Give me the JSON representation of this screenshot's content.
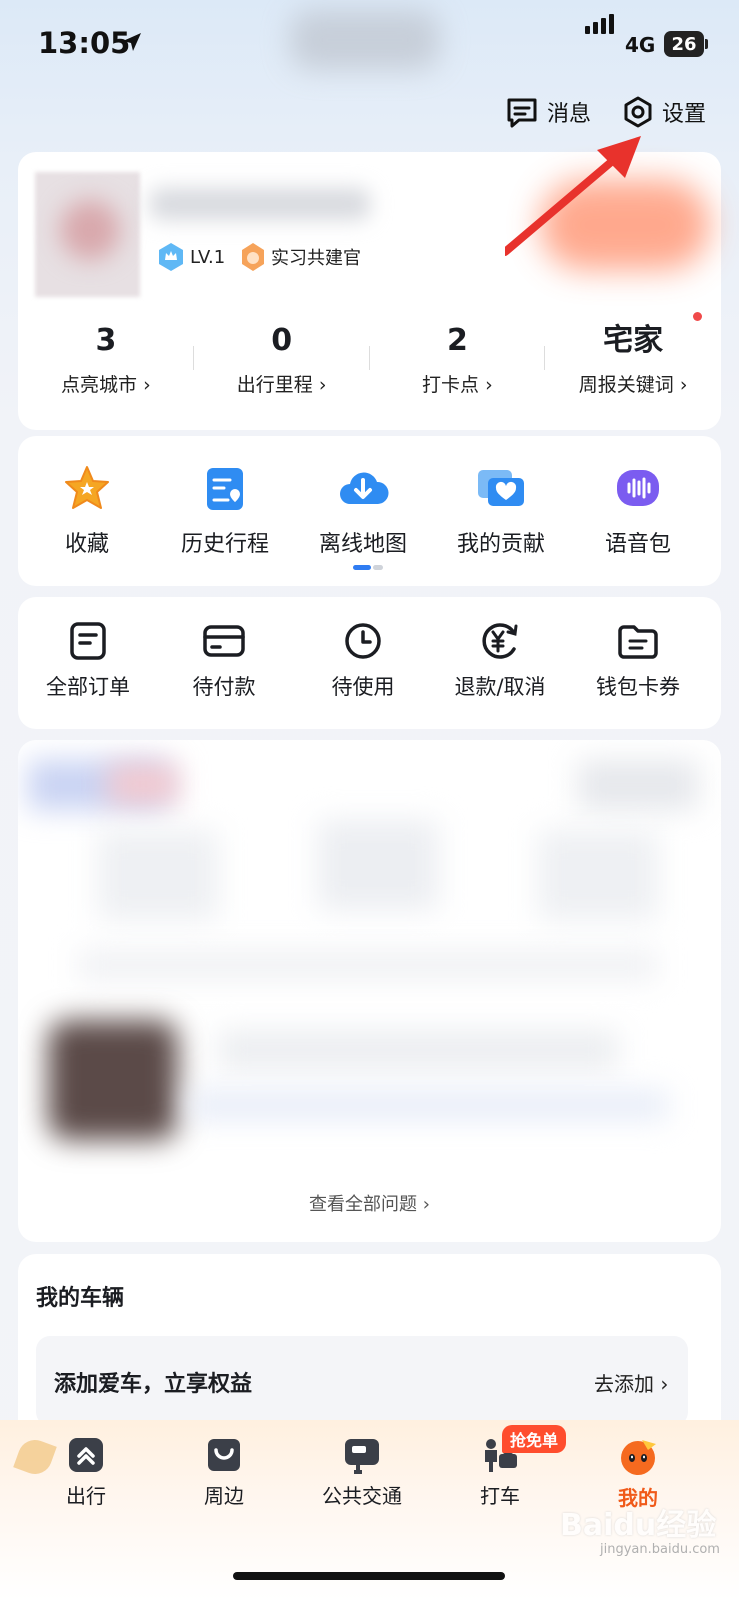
{
  "status_bar": {
    "time": "13:05",
    "network": "4G",
    "battery": "26"
  },
  "top_actions": {
    "messages": "消息",
    "settings": "设置"
  },
  "profile": {
    "level": "LV.1",
    "title_badge": "实习共建官",
    "stats": [
      {
        "value": "3",
        "label": "点亮城市 ›"
      },
      {
        "value": "0",
        "label": "出行里程 ›"
      },
      {
        "value": "2",
        "label": "打卡点 ›"
      },
      {
        "value": "宅家",
        "label": "周报关键词 ›"
      }
    ]
  },
  "tools": [
    {
      "label": "收藏",
      "icon": "star-icon"
    },
    {
      "label": "历史行程",
      "icon": "history-trip-icon"
    },
    {
      "label": "离线地图",
      "icon": "cloud-download-icon"
    },
    {
      "label": "我的贡献",
      "icon": "contribution-icon"
    },
    {
      "label": "语音包",
      "icon": "voice-pack-icon"
    }
  ],
  "orders": [
    {
      "label": "全部订单",
      "icon": "order-list-icon"
    },
    {
      "label": "待付款",
      "icon": "wallet-card-icon"
    },
    {
      "label": "待使用",
      "icon": "clock-icon"
    },
    {
      "label": "退款/取消",
      "icon": "refund-icon"
    },
    {
      "label": "钱包卡券",
      "icon": "wallet-folder-icon"
    }
  ],
  "qa": {
    "view_all": "查看全部问题 ›"
  },
  "vehicle": {
    "title": "我的车辆",
    "promo": "添加爱车，立享权益",
    "action": "去添加 ›"
  },
  "bottom_nav": {
    "items": [
      {
        "label": "出行",
        "icon": "travel-icon"
      },
      {
        "label": "周边",
        "icon": "nearby-bag-icon"
      },
      {
        "label": "公共交通",
        "icon": "bus-icon"
      },
      {
        "label": "打车",
        "icon": "taxi-icon"
      },
      {
        "label": "我的",
        "icon": "profile-mascot-icon"
      }
    ],
    "promo_badge": "抢免单",
    "active": "我的"
  },
  "watermark": {
    "main": "Baidu经验",
    "sub": "jingyan.baidu.com"
  },
  "colors": {
    "accent": "#f05a1a",
    "blue": "#3a8ef6",
    "promo": "#ff4d2d",
    "arrow": "#e8322c"
  }
}
